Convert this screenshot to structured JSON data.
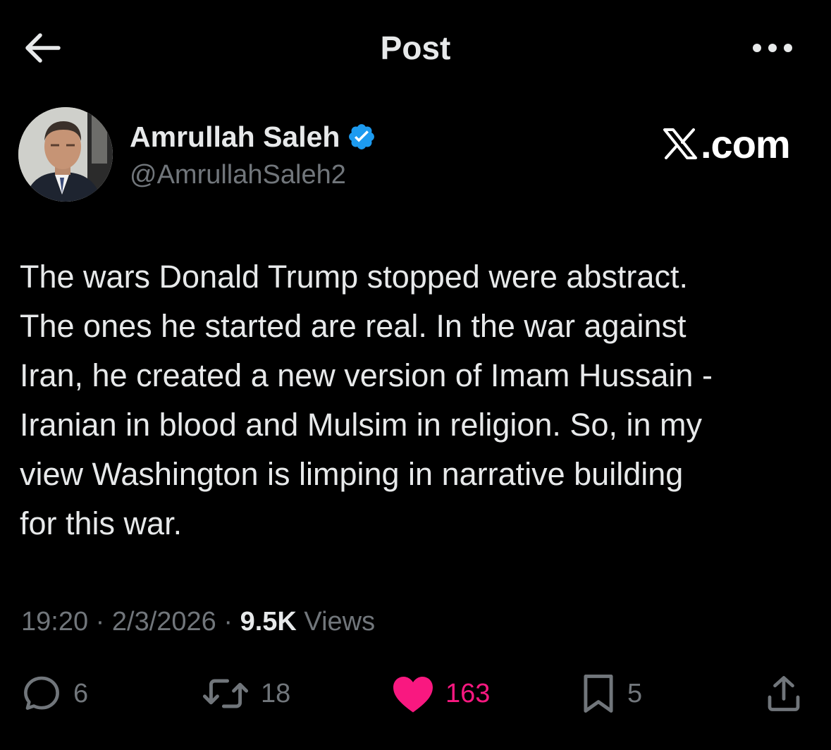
{
  "header": {
    "title": "Post",
    "back_icon": "arrow-left-icon",
    "more_icon": "more-dots-icon"
  },
  "author": {
    "display_name": "Amrullah Saleh",
    "handle": "@AmrullahSaleh2",
    "verified": true,
    "verified_color": "#1d9bf0"
  },
  "watermark": {
    "site": ".com"
  },
  "post": {
    "text": "The wars Donald Trump stopped were abstract.\nThe ones he started are real. In the war against\nIran, he created a new version of Imam Hussain -\nIranian in blood and Mulsim in religion. So, in my\nview Washington is limping in narrative building\nfor this war."
  },
  "meta": {
    "time": "19:20",
    "separator": " · ",
    "date": "2/3/2026",
    "views_count": "9.5K",
    "views_label": " Views"
  },
  "actions": {
    "reply_count": "6",
    "repost_count": "18",
    "like_count": "163",
    "bookmark_count": "5",
    "liked": true,
    "like_color": "#f91880"
  },
  "colors": {
    "background": "#000000",
    "text_primary": "#e7e9ea",
    "text_secondary": "#71767b"
  }
}
